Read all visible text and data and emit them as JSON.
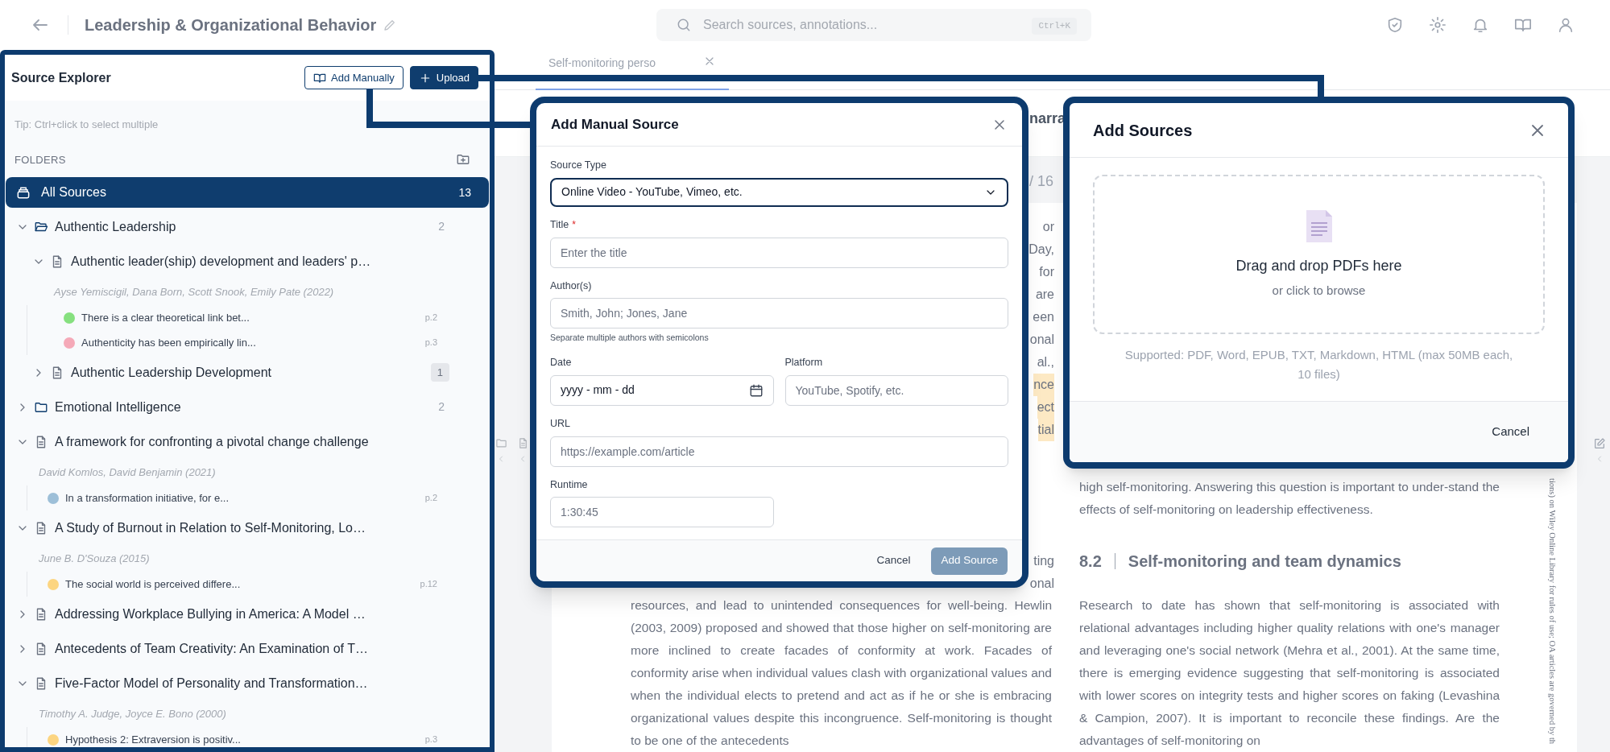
{
  "top_bar": {
    "title": "Leadership & Organizational Behavior",
    "search": {
      "placeholder": "Search sources, annotations...",
      "shortcut": "Ctrl+K"
    }
  },
  "source_explorer": {
    "title": "Source Explorer",
    "buttons": [
      {
        "label": "Add Manually",
        "kind": "outline"
      },
      {
        "label": "Upload",
        "kind": "primary"
      }
    ],
    "tip": "Tip: Ctrl+click to select multiple",
    "folders_heading": "FOLDERS",
    "all_sources": {
      "label": "All Sources",
      "count": "13",
      "selected": true
    },
    "tree": [
      {
        "kind": "folder",
        "title": "Authentic Leadership",
        "count": "2",
        "expanded": true,
        "selected": false,
        "children": [
          {
            "kind": "source",
            "title": "Authentic leader(ship) development and leaders' p…",
            "expanded": true,
            "selected": false,
            "authors": "Ayse Yemiscigil, Dana Born, Scott Snook, Emily Pate (2022)",
            "annotations": [
              {
                "text": "There is a clear theoretical link bet...",
                "page": "p.2",
                "color": "#86e07f"
              },
              {
                "text": "Authenticity has been empirically lin...",
                "page": "p.3",
                "color": "#f5a9b8"
              }
            ]
          },
          {
            "kind": "source",
            "title": "Authentic Leadership Development",
            "count": "1",
            "expanded": false,
            "selected": false
          }
        ]
      },
      {
        "kind": "folder",
        "title": "Emotional Intelligence",
        "count": "2",
        "expanded": false,
        "selected": false
      },
      {
        "kind": "source",
        "title": "A framework for confronting a pivotal change challenge",
        "expanded": true,
        "selected": false,
        "authors": "David Komlos, David Benjamin (2021)",
        "annotations": [
          {
            "text": "In a transformation initiative, for e...",
            "page": "p.2",
            "color": "#9dbfd8"
          }
        ]
      },
      {
        "kind": "source",
        "title": "A Study of Burnout in Relation to Self-Monitoring, Lo…",
        "expanded": true,
        "selected": false,
        "authors": "June B. D'Souza (2015)",
        "annotations": [
          {
            "text": "The social world is perceived differe...",
            "page": "p.12",
            "color": "#fcd581"
          }
        ]
      },
      {
        "kind": "source",
        "title": "Addressing Workplace Bullying in America: A Model …",
        "expanded": false,
        "selected": false
      },
      {
        "kind": "source",
        "title": "Antecedents of Team Creativity: An Examination of T…",
        "expanded": false,
        "selected": false
      },
      {
        "kind": "source",
        "title": "Five-Factor Model of Personality and Transformation…",
        "expanded": true,
        "selected": false,
        "authors": "Timothy A. Judge, Joyce E. Bono (2000)",
        "annotations": [
          {
            "text": "Hypothesis 2: Extraversion is positiv...",
            "page": "p.3",
            "color": "#fcd581"
          }
        ]
      }
    ]
  },
  "document": {
    "tab": {
      "label": "Self-monitoring perso",
      "selected": true
    },
    "heading_fragment": "narra",
    "page_counter": "/ 16",
    "covered_line_ends": [
      {
        "text": "or",
        "highlighted": false
      },
      {
        "text": "Day,",
        "highlighted": false
      },
      {
        "text": "for",
        "highlighted": false
      },
      {
        "text": "are",
        "highlighted": false
      },
      {
        "text": "een",
        "highlighted": false
      },
      {
        "text": "onal",
        "highlighted": false
      },
      {
        "text": "al.,",
        "highlighted": false
      },
      {
        "text": "nce",
        "highlighted": true
      },
      {
        "text": "ect",
        "highlighted": true
      },
      {
        "text": "tial",
        "highlighted": true
      }
    ],
    "lower_line_ends": [
      "ting",
      "onal"
    ],
    "left_paragraph": "resources, and lead to unintended consequences for well-being. Hewlin (2003, 2009) proposed and showed that those higher on self-monitoring are more inclined to create facades of conformity at work. Facades of conformity arise when individual values clash with organizational values and when the individual elects to pretend and act as if he or she is embracing organizational values despite this incongruence. Self-monitoring is thought to be one of the antecedents",
    "right_paragraph_end": "high self-monitoring. Answering this question is important to under-stand the effects of self-monitoring on leadership effectiveness.",
    "section_number": "8.2",
    "section_title": "Self-monitoring and team dynamics",
    "right_paragraph": "Research to date has shown that self-monitoring is associated with relational advantages including higher quality relations with one's manager and leveraging one's social network (Mehra et al., 2001). At the same time, there is emerging evidence suggesting that self-monitoring is associated with lower scores on integrity tests and higher scores on faking (Levashina & Campion, 2007). It is important to reconcile these findings. Are the advantages of self-monitoring on",
    "margin_note": "tions) on Wiley Online Library for rules of use; OA articles are governed by th"
  },
  "manual_source_dialog": {
    "title": "Add Manual Source",
    "rows": [
      [
        {
          "kind": "select",
          "label": "Source Type",
          "value": "Online Video - YouTube, Vimeo, etc."
        }
      ],
      [
        {
          "kind": "text",
          "label": "Title",
          "required_mark": "*",
          "placeholder": "Enter the title"
        }
      ],
      [
        {
          "kind": "text",
          "label": "Author(s)",
          "placeholder": "Smith, John; Jones, Jane",
          "help": "Separate multiple authors with semicolons"
        }
      ],
      [
        {
          "kind": "date",
          "label": "Date",
          "value": "yyyy - mm - dd"
        },
        {
          "kind": "text",
          "label": "Platform",
          "placeholder": "YouTube, Spotify, etc."
        }
      ],
      [
        {
          "kind": "text",
          "label": "URL",
          "placeholder": "https://example.com/article"
        }
      ],
      [
        {
          "kind": "duration",
          "label": "Runtime",
          "placeholder": "1:30:45"
        }
      ]
    ],
    "buttons": [
      {
        "label": "Cancel",
        "kind": "text",
        "disabled": false
      },
      {
        "label": "Add Source",
        "kind": "primary",
        "disabled": true
      }
    ]
  },
  "upload_dialog": {
    "title": "Add Sources",
    "dropzone": {
      "title": "Drag and drop PDFs here",
      "subtitle": "or click to browse"
    },
    "supported": "Supported: PDF, Word, EPUB, TXT, Markdown, HTML (max 50MB each, 10 files)",
    "buttons": [
      {
        "label": "Cancel"
      }
    ]
  }
}
